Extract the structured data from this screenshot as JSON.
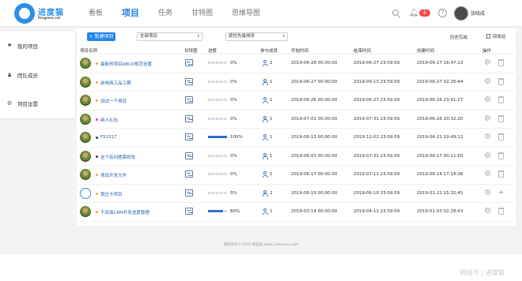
{
  "logo": {
    "name": "进度猫",
    "tagline": "Progress cat"
  },
  "nav": [
    "看板",
    "项目",
    "任务",
    "甘特图",
    "思维导图"
  ],
  "header": {
    "notification_count": "6",
    "user_name": "张晓成"
  },
  "sidebar": {
    "items": [
      {
        "label": "我的项目",
        "icon": "flag-icon"
      },
      {
        "label": "团队成员",
        "icon": "team-icon"
      },
      {
        "label": "项目设置",
        "icon": "settings-icon"
      }
    ]
  },
  "toolbar": {
    "new_label": "+ 新建项目",
    "project_filter": "全部项目",
    "sort_filter": "按优先级排序",
    "history_label": "历史完成",
    "recycle_label": "回收站"
  },
  "table": {
    "headers": [
      "项目名称",
      "甘特图",
      "进度",
      "参与成员",
      "开始时间",
      "结束时间",
      "创建时间",
      "操作"
    ],
    "rows": [
      {
        "avatar": "photo",
        "status_color": "#f5a623",
        "name": "最新的项目ABCD规范设置",
        "progress": 0,
        "progress_text": "0%",
        "members": "2",
        "start": "2019-06-28 00:00:00",
        "end": "2019-06-27 23:59:59",
        "created": "2019-06-27 16:47:13",
        "action": "delete"
      },
      {
        "avatar": "photo",
        "status_color": "#f5a623",
        "name": "前电商工品工期",
        "progress": 0,
        "progress_text": "0%",
        "members": "1",
        "start": "2019-06-27 00:00:00",
        "end": "2019-09-13 23:59:59",
        "created": "2019-06-27 02:26:44",
        "action": "delete"
      },
      {
        "avatar": "photo",
        "status_color": "#f5a623",
        "name": "测试一个项目",
        "progress": 0,
        "progress_text": "0%",
        "members": "1",
        "start": "2019-06-26 00:00:00",
        "end": "2019-06-27 23:59:59",
        "created": "2019-06-26 23:41:27",
        "action": "delete"
      },
      {
        "avatar": "photo",
        "status_color": "#e0457b",
        "name": "新人礼包",
        "progress": 0,
        "progress_text": "0%",
        "members": "1",
        "start": "2019-07-01 00:00:00",
        "end": "2019-07-31 23:59:59",
        "created": "2019-06-26 20:32:20",
        "action": "delete"
      },
      {
        "avatar": "photo",
        "status_color": "#3a3a3a",
        "name": "FS1517",
        "progress": 100,
        "progress_text": "100%",
        "members": "1",
        "start": "2019-06-13 00:00:00",
        "end": "2019-12-02 23:59:59",
        "created": "2019-06-21 19:49:12",
        "action": "delete"
      },
      {
        "avatar": "photo",
        "status_color": "#3a3a3a",
        "name": "这个有问题需修改",
        "progress": 0,
        "progress_text": "0%",
        "members": "1",
        "start": "2019-06-03 00:00:00",
        "end": "2019-07-31 23:59:59",
        "created": "2019-06-17 00:11:50",
        "action": "delete"
      },
      {
        "avatar": "photo",
        "status_color": "#f5a623",
        "name": "项目开发文件",
        "progress": 0,
        "progress_text": "0%",
        "members": "1",
        "start": "2019-06-17 00:00:00",
        "end": "2019-07-11 23:59:59",
        "created": "2019-06-14 17:18:38",
        "action": "delete"
      },
      {
        "avatar": "logo",
        "status_color": "#f5a623",
        "name": "我位卡项目",
        "progress": 0,
        "progress_text": "0%",
        "members": "2",
        "start": "2019-06-10 00:00:00",
        "end": "2019-06-10 23:59:59",
        "created": "2019-01-22 15:32:45",
        "action": "exit"
      },
      {
        "avatar": "photo",
        "status_color": "#f5a623",
        "name": "千百商CRM开发进度管理",
        "progress": 80,
        "progress_text": "80%",
        "members": "1",
        "start": "2019-03-14 00:00:00",
        "end": "2019-04-11 23:59:59",
        "created": "2019-01-03 02:28:43",
        "action": "delete"
      }
    ]
  },
  "footer": {
    "copyright": "版权所有©2019 进度猫 www.jindumao.com"
  },
  "watermark": "网易号 | 进度猫"
}
